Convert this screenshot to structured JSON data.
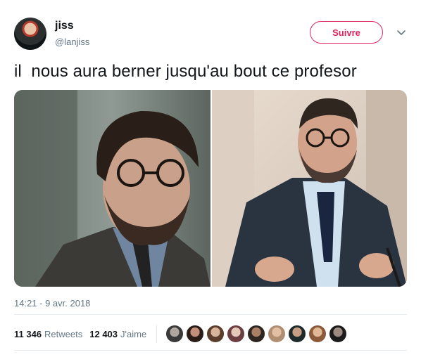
{
  "author": {
    "name": "jiss",
    "handle": "@lanjiss",
    "follow_label": "Suivre"
  },
  "tweet": {
    "text": "il  nous aura berner jusqu'au bout ce profesor",
    "timestamp": "14:21 - 9 avr. 2018"
  },
  "media": {
    "panels": [
      "left-portrait",
      "right-portrait"
    ]
  },
  "stats": {
    "retweets_count": "11 346",
    "retweets_label": "Retweets",
    "likes_count": "12 403",
    "likes_label": "J'aime"
  },
  "likers": [
    "liker-avatar",
    "liker-avatar",
    "liker-avatar",
    "liker-avatar",
    "liker-avatar",
    "liker-avatar",
    "liker-avatar",
    "liker-avatar",
    "liker-avatar"
  ],
  "colors": {
    "accent": "#e0245e",
    "text": "#14171a",
    "secondary": "#657786",
    "divider": "#e6ecf0"
  },
  "icons": {
    "menu": "chevron-down-icon"
  }
}
